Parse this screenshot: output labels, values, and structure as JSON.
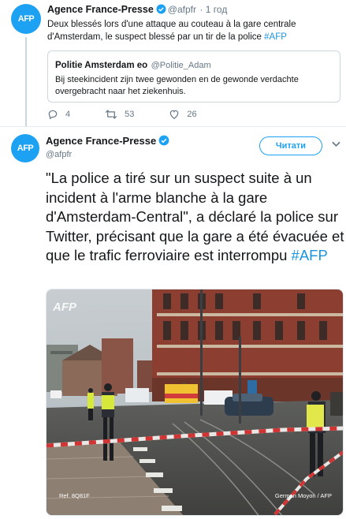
{
  "tweet1": {
    "author_name": "Agence France-Presse",
    "author_handle": "@afpfr",
    "time": "· 1 год",
    "avatar_text": "AFP",
    "text_main": "Deux blessés lors d'une attaque au couteau à la gare centrale d'Amsterdam, le suspect blessé par un tir de la police ",
    "text_hashtag": "#AFP",
    "quote": {
      "name": "Politie Amsterdam eo",
      "handle": "@Politie_Adam",
      "text": "Bij steekincident zijn twee gewonden en de gewonde verdachte overgebracht naar het ziekenhuis."
    },
    "actions": {
      "replies": "4",
      "retweets": "53",
      "likes": "26"
    }
  },
  "tweet2": {
    "author_name": "Agence France-Presse",
    "author_handle": "@afpfr",
    "avatar_text": "AFP",
    "follow_label": "Читати",
    "text_main": "\"La police a tiré sur un suspect suite à un incident à l'arme blanche à la gare d'Amsterdam-Central\", a déclaré la police sur Twitter, précisant que la gare a été évacuée et que le trafic ferroviaire est interrompu ",
    "text_hashtag": "#AFP",
    "photo": {
      "watermark": "AFP",
      "ref": "Ref. 8Q81F",
      "credit": "German Moyon / AFP"
    }
  },
  "colors": {
    "brand": "#1da1f2",
    "link": "#1b95e0",
    "secondary": "#657786"
  }
}
